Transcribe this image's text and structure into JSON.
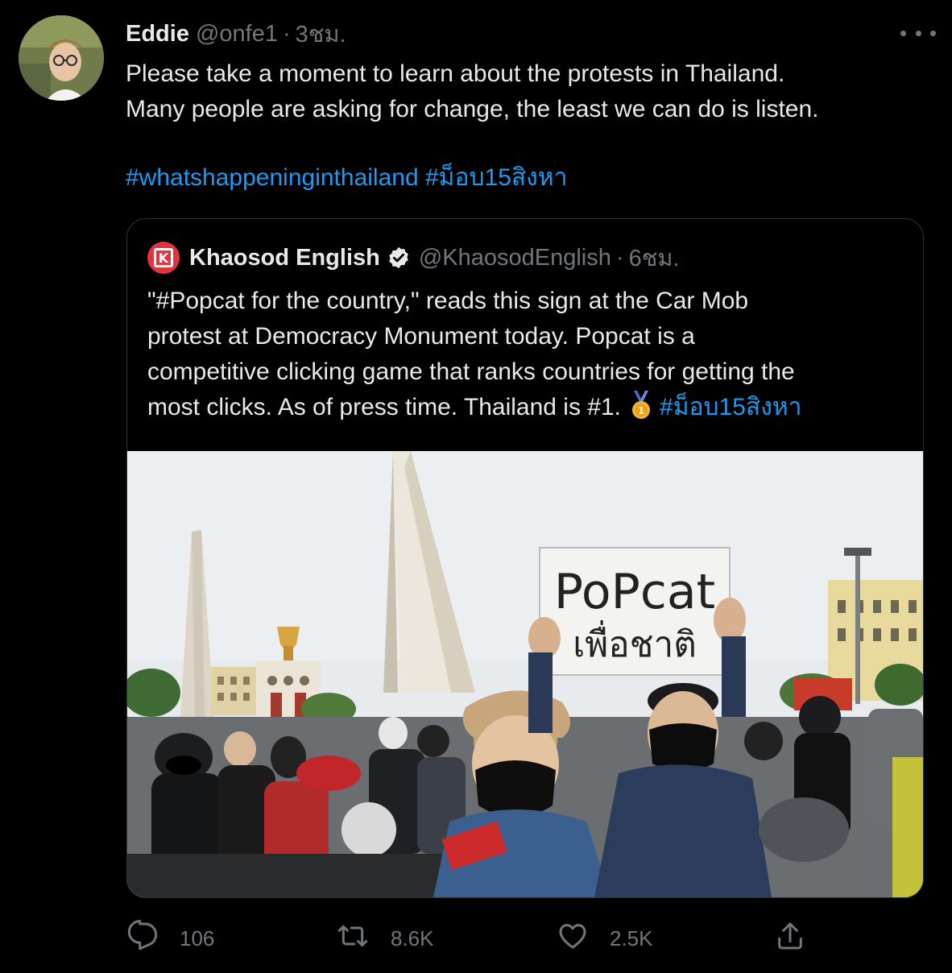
{
  "tweet": {
    "author_name": "Eddie",
    "author_handle": "@onfe1",
    "timestamp": "3ชม.",
    "text_lines": [
      "Please take a moment to learn about the protests in Thailand.",
      "Many people are asking for change, the least we can do is listen."
    ],
    "hashtags": [
      "#whatshappeninginthailand",
      "#ม็อบ15สิงหา"
    ]
  },
  "quoted_tweet": {
    "author_name": "Khaosod English",
    "author_handle": "@KhaosodEnglish",
    "timestamp": "6ชม.",
    "avatar_letter": "K",
    "text_lines": [
      "\"#Popcat for the country,\" reads this sign at the Car Mob",
      "protest at Democracy Monument today. Popcat is a",
      "competitive clicking game that ranks countries for getting the",
      "most clicks. As of press time. Thailand is #1."
    ],
    "hashtag": "#ม็อบ15สิงหา",
    "photo_sign_line1": "PoPcat",
    "photo_sign_line2": "เพื่อชาติ"
  },
  "actions": {
    "reply_count": "106",
    "retweet_count": "8.6K",
    "like_count": "2.5K"
  },
  "colors": {
    "background": "#000000",
    "text": "#e7e9ea",
    "muted": "#71767b",
    "link": "#1d9bf0",
    "border": "#2f3336"
  },
  "icons": [
    "more-icon",
    "verified-icon",
    "medal-icon",
    "reply-icon",
    "retweet-icon",
    "like-icon",
    "share-icon"
  ]
}
